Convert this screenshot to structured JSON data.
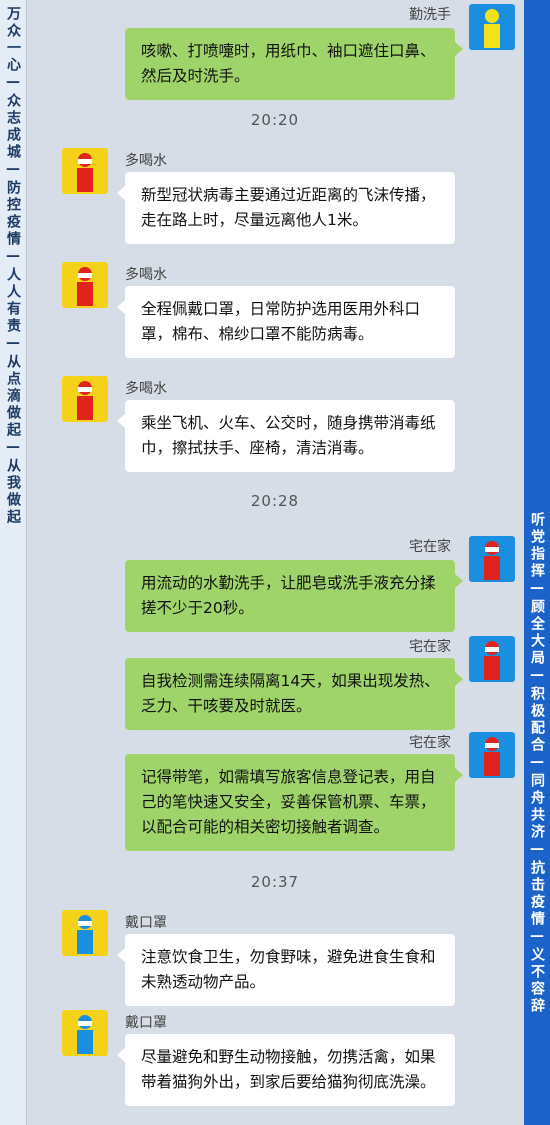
{
  "banners": {
    "left": "万众一心—众志成城—防控疫情—人人有责—从点滴做起—从我做起",
    "right": "听党指挥—顾全大局—积极配合—同舟共济—抗击疫情—义不容辞"
  },
  "colors": {
    "green_bubble": "#9fd46a",
    "white_bubble": "#ffffff",
    "background": "#d6dde6",
    "right_banner": "#1b63c9"
  },
  "timestamps": [
    "20:20",
    "20:28",
    "20:37"
  ],
  "messages": [
    {
      "sender": "勤洗手",
      "avatar_icon": "person-yellow-on-blue-icon",
      "text": "咳嗽、打喷嚏时，用纸巾、袖口遮住口鼻、然后及时洗手。"
    },
    {
      "sender": "多喝水",
      "avatar_icon": "person-red-on-yellow-icon",
      "text": "新型冠状病毒主要通过近距离的飞沫传播，走在路上时，尽量远离他人1米。"
    },
    {
      "sender": "多喝水",
      "avatar_icon": "person-red-on-yellow-icon",
      "text": "全程佩戴口罩，日常防护选用医用外科口罩，棉布、棉纱口罩不能防病毒。"
    },
    {
      "sender": "多喝水",
      "avatar_icon": "person-red-on-yellow-icon",
      "text": "乘坐飞机、火车、公交时，随身携带消毒纸巾，擦拭扶手、座椅，清洁消毒。"
    },
    {
      "sender": "宅在家",
      "avatar_icon": "person-red-on-blue-icon",
      "text": "用流动的水勤洗手，让肥皂或洗手液充分揉搓不少于20秒。"
    },
    {
      "sender": "宅在家",
      "avatar_icon": "person-red-on-blue-icon",
      "text": "自我检测需连续隔离14天，如果出现发热、乏力、干咳要及时就医。"
    },
    {
      "sender": "宅在家",
      "avatar_icon": "person-red-on-blue-icon",
      "text": "记得带笔，如需填写旅客信息登记表，用自己的笔快速又安全，妥善保管机票、车票，以配合可能的相关密切接触者调查。"
    },
    {
      "sender": "戴口罩",
      "avatar_icon": "person-blue-on-yellow-icon",
      "text": "注意饮食卫生，勿食野味，避免进食生食和未熟透动物产品。"
    },
    {
      "sender": "戴口罩",
      "avatar_icon": "person-blue-on-yellow-icon",
      "text": "尽量避免和野生动物接触，勿携活禽，如果带着猫狗外出，到家后要给猫狗彻底洗澡。"
    }
  ]
}
